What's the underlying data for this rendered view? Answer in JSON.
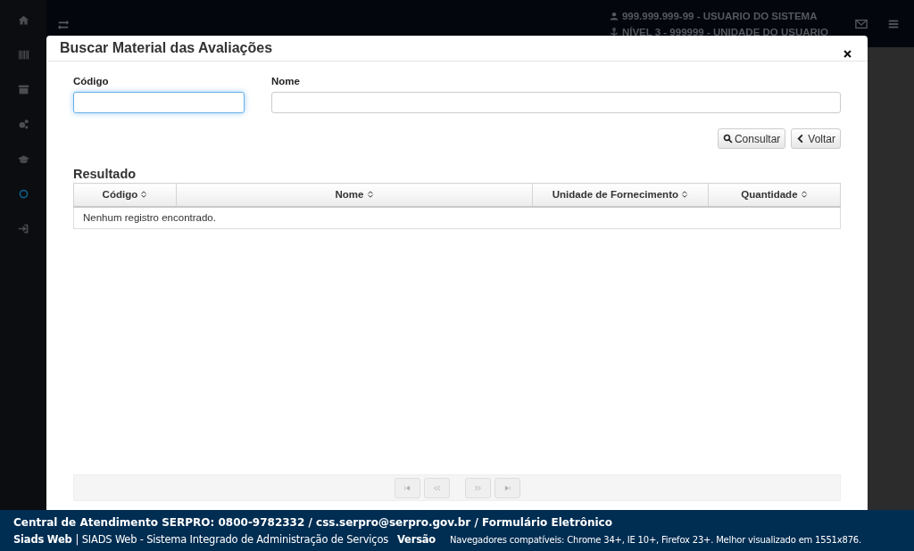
{
  "header": {
    "user": "999.999.999-99 - USUARIO DO SISTEMA",
    "unit": "NÍVEL 3 - 999999 - UNIDADE DO USUARIO"
  },
  "modal": {
    "title": "Buscar Material das Avaliações",
    "fields": [
      {
        "label": "Código",
        "focused": true
      },
      {
        "label": "Nome",
        "focused": false
      }
    ],
    "buttons": [
      {
        "label": "Consultar",
        "kind": "search"
      },
      {
        "label": "Voltar",
        "kind": "back"
      }
    ],
    "result": {
      "title": "Resultado",
      "columns": [
        "Código",
        "Nome",
        "Unidade de Fornecimento",
        "Quantidade"
      ],
      "empty_message": "Nenhum registro encontrado."
    },
    "pager": [
      {
        "kind": "first",
        "disabled": true
      },
      {
        "kind": "prev",
        "disabled": true
      },
      {
        "kind": "next",
        "disabled": true
      },
      {
        "kind": "last",
        "disabled": true
      }
    ]
  },
  "footer": {
    "contact": "Central de Atendimento SERPRO: 0800-9782332 / css.serpro@serpro.gov.br / Formulário Eletrônico",
    "app": "Siads Web",
    "description": "| SIADS Web - Sistema Integrado de Administração de Serviços",
    "version_label": "Versão",
    "browsers": "Navegadores compatíveis: Chrome 34+, IE 10+, Firefox 23+. Melhor visualizado em 1551x876."
  }
}
